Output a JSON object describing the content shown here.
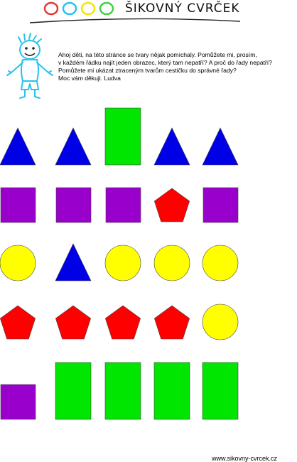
{
  "header": {
    "brand": "ŠIKOVNÝ CVRČEK",
    "logo_colors": [
      "#e53935",
      "#27c3ee",
      "#f2e600",
      "#3dd43d"
    ]
  },
  "intro": {
    "lines": [
      "Ahoj děti, na této stránce se tvary nějak pomíchaly. Pomůžete mi, prosím,",
      "v každém řádku najít jeden obrazec, který tam nepatří? A proč do řady nepatří?",
      "Pomůžete mi ukázat ztraceným tvarům cestičku do správné řady?",
      "Moc vám děkuji. Ludva"
    ]
  },
  "colors": {
    "triangle": "#0000e6",
    "rectangle": "#00e600",
    "square": "#9900cc",
    "pentagon": "#ff0000",
    "circle": "#ffff00"
  },
  "rows": [
    [
      "triangle",
      "triangle",
      "rectangle",
      "triangle",
      "triangle"
    ],
    [
      "square",
      "square",
      "square",
      "pentagon",
      "square"
    ],
    [
      "circle",
      "triangle",
      "circle",
      "circle",
      "circle"
    ],
    [
      "pentagon",
      "pentagon",
      "pentagon",
      "pentagon",
      "circle"
    ],
    [
      "square",
      "rectangle",
      "rectangle",
      "rectangle",
      "rectangle"
    ]
  ],
  "footer": {
    "url": "www.sikovny-cvrcek.cz"
  }
}
